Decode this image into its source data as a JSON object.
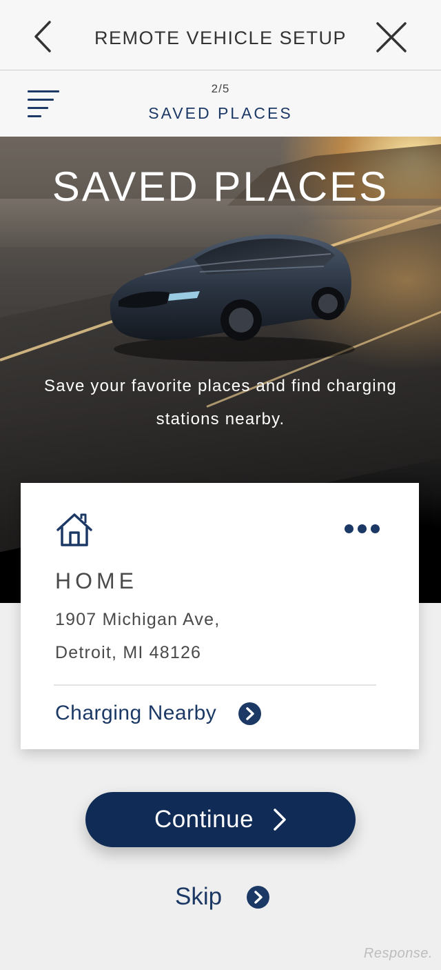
{
  "header": {
    "title": "REMOTE VEHICLE SETUP",
    "back_icon": "chevron-left-icon",
    "close_icon": "close-icon"
  },
  "stepper": {
    "menu_icon": "menu-icon",
    "step": "2/5",
    "name": "SAVED PLACES"
  },
  "hero": {
    "title": "SAVED PLACES",
    "description": "Save your favorite places and find charging stations nearby."
  },
  "place_card": {
    "icon": "home-icon",
    "more_icon": "more-options-icon",
    "name": "HOME",
    "address_line1": "1907 Michigan Ave,",
    "address_line2": "Detroit, MI 48126",
    "action_label": "Charging Nearby",
    "action_icon": "chevron-right-circle-icon"
  },
  "actions": {
    "continue_label": "Continue",
    "skip_label": "Skip"
  },
  "watermark": "Response.",
  "colors": {
    "brand_navy": "#102b55",
    "text_navy": "#1c3966",
    "background": "#efefef"
  }
}
